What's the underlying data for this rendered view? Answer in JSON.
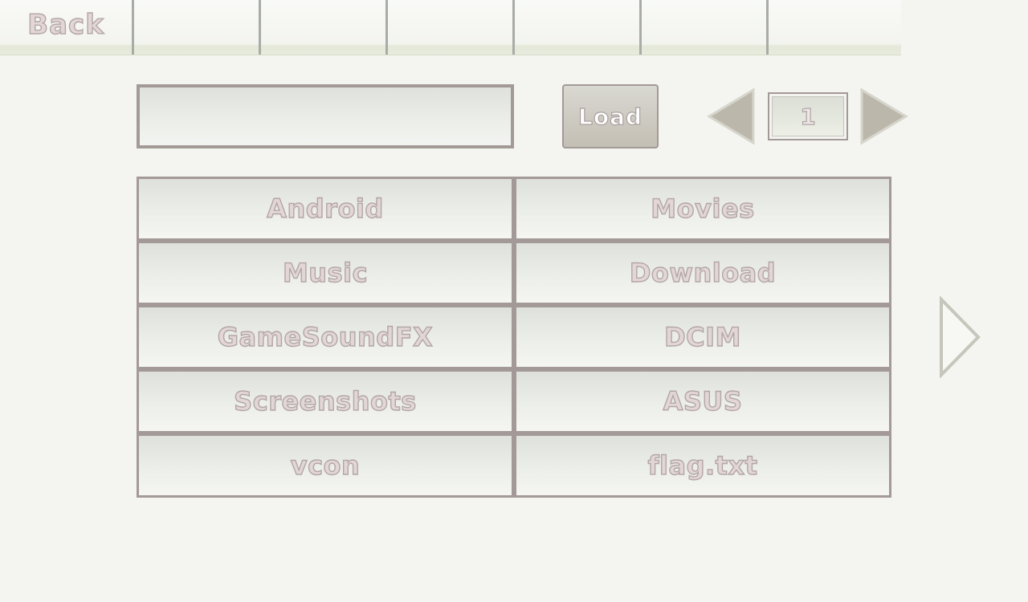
{
  "topbar": {
    "back_label": "Back",
    "empty_tab_count_note": ""
  },
  "path_input": {
    "value": "",
    "placeholder": ""
  },
  "load_button": {
    "label": "Load"
  },
  "pager": {
    "page": "1"
  },
  "files": [
    {
      "label": "Android"
    },
    {
      "label": "Movies"
    },
    {
      "label": "Music"
    },
    {
      "label": "Download"
    },
    {
      "label": "GameSoundFX"
    },
    {
      "label": "DCIM"
    },
    {
      "label": "Screenshots"
    },
    {
      "label": "ASUS"
    },
    {
      "label": "vcon"
    },
    {
      "label": "flag.txt"
    }
  ],
  "icons": {
    "prev": "triangle-left-icon",
    "next": "triangle-right-icon",
    "side_next": "triangle-right-outline-icon"
  },
  "colors": {
    "background": "#f4f5f0",
    "border": "#a39997",
    "text_fill": "#e2d6d6",
    "text_stroke": "#b3a6a6",
    "arrow_fill": "#bcb7ab"
  }
}
